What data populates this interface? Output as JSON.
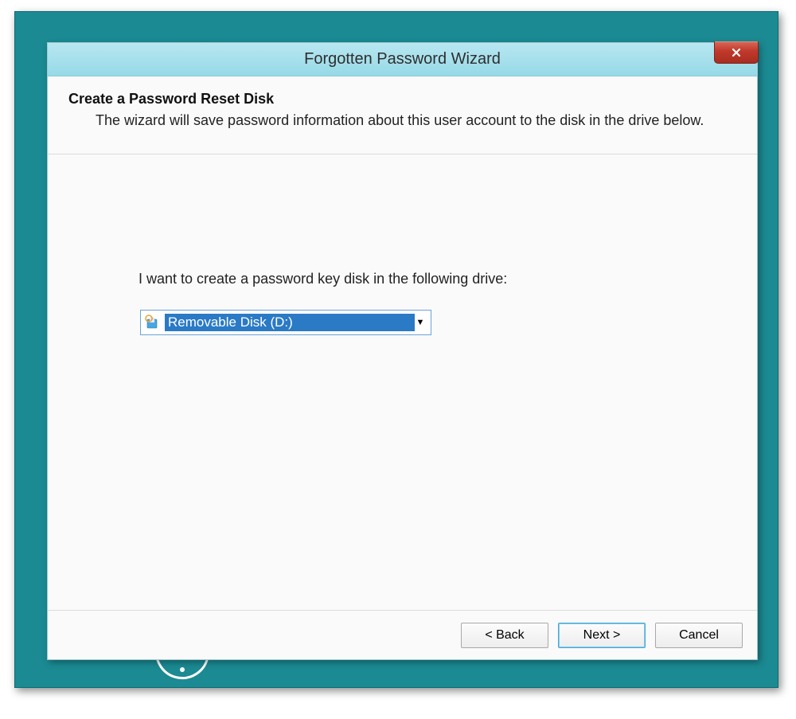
{
  "window": {
    "title": "Forgotten Password Wizard"
  },
  "header": {
    "title": "Create a Password Reset Disk",
    "description": "The wizard will save password information about this user account to the disk in the drive below."
  },
  "content": {
    "prompt": "I want to create a password key disk in the following drive:",
    "drive_select": {
      "selected": "Removable Disk (D:)"
    }
  },
  "footer": {
    "back": "< Back",
    "next": "Next >",
    "cancel": "Cancel"
  }
}
